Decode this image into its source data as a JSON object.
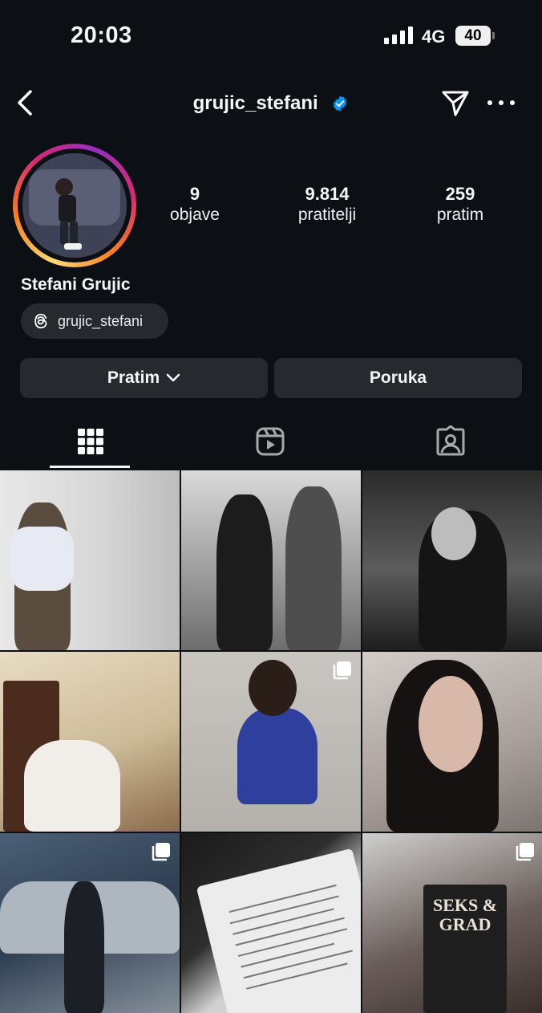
{
  "status_bar": {
    "time": "20:03",
    "network": "4G",
    "battery": "40"
  },
  "header": {
    "username": "grujic_stefani"
  },
  "profile": {
    "stats": [
      {
        "value": "9",
        "label": "objave"
      },
      {
        "value": "9.814",
        "label": "pratitelji"
      },
      {
        "value": "259",
        "label": "pratim"
      }
    ],
    "full_name": "Stefani Grujic",
    "threads_handle": "grujic_stefani"
  },
  "actions": {
    "following_label": "Pratim",
    "message_label": "Poruka"
  },
  "tabs": [
    "grid-icon",
    "reels-icon",
    "tagged-icon"
  ],
  "grid": {
    "posts": [
      {
        "multi": false,
        "book_text": ""
      },
      {
        "multi": false,
        "book_text": ""
      },
      {
        "multi": false,
        "book_text": ""
      },
      {
        "multi": false,
        "book_text": ""
      },
      {
        "multi": true,
        "book_text": ""
      },
      {
        "multi": false,
        "book_text": ""
      },
      {
        "multi": true,
        "book_text": ""
      },
      {
        "multi": false,
        "book_text": ""
      },
      {
        "multi": true,
        "book_text": "SEKS & GRAD"
      }
    ]
  },
  "colors": {
    "background": "#0c1014",
    "button": "#262a2f",
    "verified": "#0095f6"
  }
}
